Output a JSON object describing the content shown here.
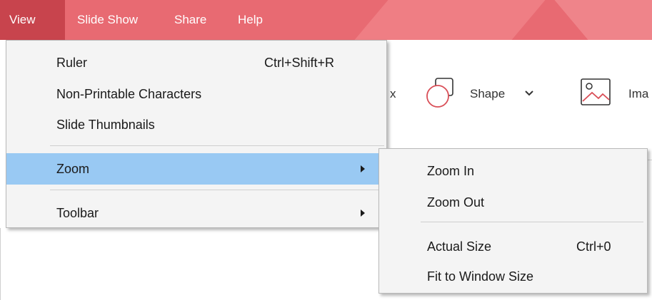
{
  "menubar": {
    "items": [
      {
        "label": "View",
        "active": true
      },
      {
        "label": "Slide Show",
        "active": false
      },
      {
        "label": "Share",
        "active": false
      },
      {
        "label": "Help",
        "active": false
      }
    ],
    "colors": {
      "bar": "#e86a72",
      "active": "#c8444d"
    }
  },
  "ribbon": {
    "partial_label": "x",
    "shape_label": "Shape",
    "image_label": "Ima",
    "icons": [
      "shape-icon",
      "chevron-down-icon",
      "image-icon"
    ]
  },
  "view_menu": {
    "items": [
      {
        "label": "Ruler",
        "shortcut": "Ctrl+Shift+R"
      },
      {
        "label": "Non-Printable Characters"
      },
      {
        "label": "Slide Thumbnails"
      },
      {
        "label": "Zoom",
        "submenu": true,
        "highlighted": true
      },
      {
        "label": "Toolbar",
        "submenu": true
      }
    ],
    "highlight_color": "#99c9f3"
  },
  "zoom_menu": {
    "items": [
      {
        "label": "Zoom In"
      },
      {
        "label": "Zoom Out"
      },
      {
        "label": "Actual Size",
        "shortcut": "Ctrl+0"
      },
      {
        "label": "Fit to Window Size"
      }
    ]
  }
}
